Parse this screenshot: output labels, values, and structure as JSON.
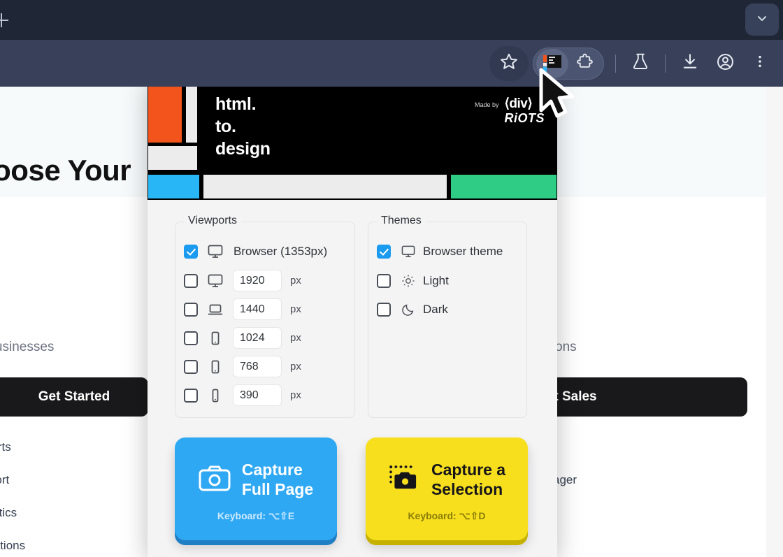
{
  "browser": {
    "newtab_icon": "plus-icon",
    "tabstrip_chevron_icon": "chevron-down-icon",
    "toolbar_icons": [
      {
        "name": "bookmark-star-icon",
        "label": "Bookmark this tab"
      },
      {
        "name": "htmltodesign-extension-icon",
        "label": "html.to.design"
      },
      {
        "name": "extensions-puzzle-icon",
        "label": "Extensions"
      },
      {
        "name": "experiments-flask-icon",
        "label": "Experiments"
      },
      {
        "name": "downloads-icon",
        "label": "Downloads"
      },
      {
        "name": "profile-avatar-icon",
        "label": "Profile"
      },
      {
        "name": "more-kebab-icon",
        "label": "Customize and control"
      }
    ]
  },
  "page": {
    "title": "hoose Your",
    "subtitle_left": "wing businesses",
    "subtitle_right": "ons",
    "button_left": "Get Started",
    "button_right": "t Sales",
    "features_left": [
      "imports",
      "upport",
      "analytics",
      "ntegrations"
    ],
    "features_right": [
      "ager"
    ]
  },
  "popup": {
    "brand": {
      "line1": "html.",
      "line2": "to.",
      "line3": "design",
      "made_by_label": "Made by",
      "made_by_name_1": "⟨div⟩",
      "made_by_name_2": "RiOTS"
    },
    "colors": {
      "orange": "#f2541b",
      "cyan": "#29b6f6",
      "green": "#2ecc84",
      "gray": "#ececec",
      "accent_blue": "#1a9bf0",
      "capture_blue": "#2fa8f4",
      "capture_yellow": "#f7df1e"
    },
    "viewports": {
      "legend": "Viewports",
      "items": [
        {
          "checked": true,
          "icon": "monitor-icon",
          "label": "Browser (1353px)",
          "value": null,
          "unit": null
        },
        {
          "checked": false,
          "icon": "monitor-icon",
          "label": null,
          "value": "1920",
          "unit": "px"
        },
        {
          "checked": false,
          "icon": "laptop-icon",
          "label": null,
          "value": "1440",
          "unit": "px"
        },
        {
          "checked": false,
          "icon": "tablet-icon",
          "label": null,
          "value": "1024",
          "unit": "px"
        },
        {
          "checked": false,
          "icon": "tablet-icon",
          "label": null,
          "value": "768",
          "unit": "px"
        },
        {
          "checked": false,
          "icon": "phone-icon",
          "label": null,
          "value": "390",
          "unit": "px"
        }
      ]
    },
    "themes": {
      "legend": "Themes",
      "items": [
        {
          "checked": true,
          "icon": "monitor-icon",
          "label": "Browser theme"
        },
        {
          "checked": false,
          "icon": "sun-icon",
          "label": "Light"
        },
        {
          "checked": false,
          "icon": "moon-icon",
          "label": "Dark"
        }
      ]
    },
    "actions": [
      {
        "id": "capture-full-page",
        "icon": "camera-icon",
        "line1": "Capture",
        "line2": "Full Page",
        "shortcut": "Keyboard: ⌥⇧E"
      },
      {
        "id": "capture-selection",
        "icon": "camera-selection-icon",
        "line1": "Capture a",
        "line2": "Selection",
        "shortcut": "Keyboard: ⌥⇧D"
      }
    ]
  }
}
